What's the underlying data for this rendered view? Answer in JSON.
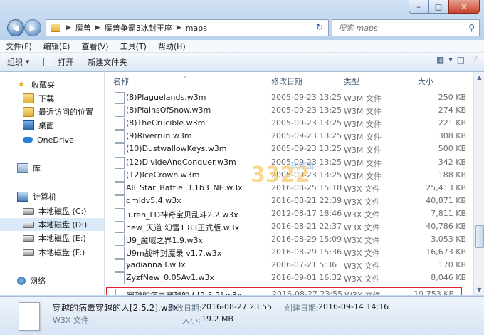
{
  "window": {
    "caption_buttons": [
      "minimize-icon",
      "maximize-icon",
      "close-icon"
    ]
  },
  "address": {
    "crumbs": [
      "魔兽",
      "魔兽争霸3冰封王座",
      "maps"
    ]
  },
  "search": {
    "placeholder": "搜索 maps"
  },
  "menu": [
    "文件(F)",
    "编辑(E)",
    "查看(V)",
    "工具(T)",
    "帮助(H)"
  ],
  "toolbar": {
    "organize": "组织",
    "open": "打开",
    "new_folder": "新建文件夹"
  },
  "nav": {
    "favorites": "收藏夹",
    "downloads": "下载",
    "recent": "最近访问的位置",
    "desktop": "桌面",
    "onedrive": "OneDrive",
    "library": "库",
    "computer": "计算机",
    "drive_c": "本地磁盘 (C:)",
    "drive_d": "本地磁盘 (D:)",
    "drive_e": "本地磁盘 (E:)",
    "drive_f": "本地磁盘 (F:)",
    "network": "网络"
  },
  "columns": {
    "name": "名称",
    "date": "修改日期",
    "type": "类型",
    "size": "大小"
  },
  "files": [
    {
      "name": "(8)Plaguelands.w3m",
      "date": "2005-09-23 13:25",
      "type": "W3M 文件",
      "size": "250 KB"
    },
    {
      "name": "(8)PlainsOfSnow.w3m",
      "date": "2005-09-23 13:25",
      "type": "W3M 文件",
      "size": "274 KB"
    },
    {
      "name": "(8)TheCrucible.w3m",
      "date": "2005-09-23 13:25",
      "type": "W3M 文件",
      "size": "221 KB"
    },
    {
      "name": "(9)Riverrun.w3m",
      "date": "2005-09-23 13:25",
      "type": "W3M 文件",
      "size": "308 KB"
    },
    {
      "name": "(10)DustwallowKeys.w3m",
      "date": "2005-09-23 13:25",
      "type": "W3M 文件",
      "size": "500 KB"
    },
    {
      "name": "(12)DivideAndConquer.w3m",
      "date": "2005-09-23 13:25",
      "type": "W3M 文件",
      "size": "342 KB"
    },
    {
      "name": "(12)IceCrown.w3m",
      "date": "2005-09-23 13:25",
      "type": "W3M 文件",
      "size": "188 KB"
    },
    {
      "name": "All_Star_Battle_3.1b3_NE.w3x",
      "date": "2016-08-25 15:18",
      "type": "W3X 文件",
      "size": "25,413 KB"
    },
    {
      "name": "dmldv5.4.w3x",
      "date": "2016-08-21 22:39",
      "type": "W3X 文件",
      "size": "40,871 KB"
    },
    {
      "name": "luren_LD神奇宝贝乱斗2.2.w3x",
      "date": "2012-08-17 18:46",
      "type": "W3X 文件",
      "size": "7,811 KB"
    },
    {
      "name": "new_天道 幻雪1.83正式版.w3x",
      "date": "2016-08-21 22:37",
      "type": "W3X 文件",
      "size": "40,786 KB"
    },
    {
      "name": "U9_魔域之界1.9.w3x",
      "date": "2016-08-29 15:09",
      "type": "W3X 文件",
      "size": "3,053 KB"
    },
    {
      "name": "U9m战神封魔录 v1.7.w3x",
      "date": "2016-08-29 15:36",
      "type": "W3X 文件",
      "size": "16,673 KB"
    },
    {
      "name": "yadianna3.w3x",
      "date": "2006-07-21 5:36",
      "type": "W3X 文件",
      "size": "170 KB"
    },
    {
      "name": "ZyzfNew_0.05Av1.w3x",
      "date": "2016-09-01 16:32",
      "type": "W3X 文件",
      "size": "8,046 KB"
    },
    {
      "name": "穿越的病毒穿越的人[2.5.2].w3x",
      "date": "2016-08-27 23:55",
      "type": "W3X 文件",
      "size": "19,753 KB"
    }
  ],
  "details": {
    "filename": "穿越的病毒穿越的人[2.5.2].w3x",
    "type": "W3X 文件",
    "modified_label": "修改日期:",
    "modified": "2016-08-27 23:55",
    "created_label": "创建日期:",
    "created": "2016-09-14 14:16",
    "size_label": "大小:",
    "size": "19.2 MB"
  },
  "watermark": {
    "logo": "3322",
    "text": "软件园"
  }
}
